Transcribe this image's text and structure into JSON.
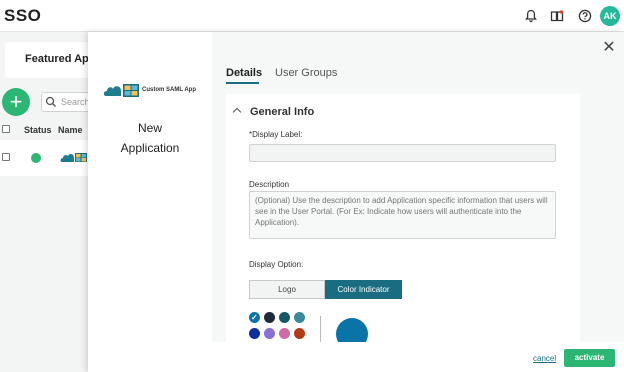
{
  "header": {
    "app_title": "SSO",
    "icons": [
      "bell-icon",
      "book-icon",
      "help-icon"
    ],
    "avatar_initials": "AK"
  },
  "background": {
    "featured_tab": "Featured App",
    "search_placeholder": "Search",
    "columns": [
      "Status",
      "Name"
    ]
  },
  "modal": {
    "app_type_label": "Custom SAML App",
    "app_name": "New Application",
    "tabs": [
      {
        "label": "Details",
        "active": true
      },
      {
        "label": "User Groups",
        "active": false
      }
    ],
    "section_title": "General Info",
    "display_label": {
      "label": "*Display Label:",
      "value": ""
    },
    "description": {
      "label": "Description",
      "placeholder": "(Optional) Use the description to add Application specific information that users will see in the User Portal. (For Ex: Indicate how users will authenticate into the Application)."
    },
    "display_option": {
      "label": "Display Option:",
      "options": [
        "Logo",
        "Color Indicator"
      ],
      "selected": "Color Indicator"
    },
    "swatches": [
      "#0a74a8",
      "#1f2b3a",
      "#16586a",
      "#3a8a9a",
      "#0b2f9c",
      "#8a70d6",
      "#d06aa8",
      "#b23a16"
    ],
    "selected_swatch": "#0a74a8",
    "preview_color": "#0a74a8",
    "footer": {
      "cancel_label": "cancel",
      "activate_label": "activate"
    }
  },
  "colors": {
    "accent": "#1a6d80",
    "primary_green": "#2bb673"
  }
}
